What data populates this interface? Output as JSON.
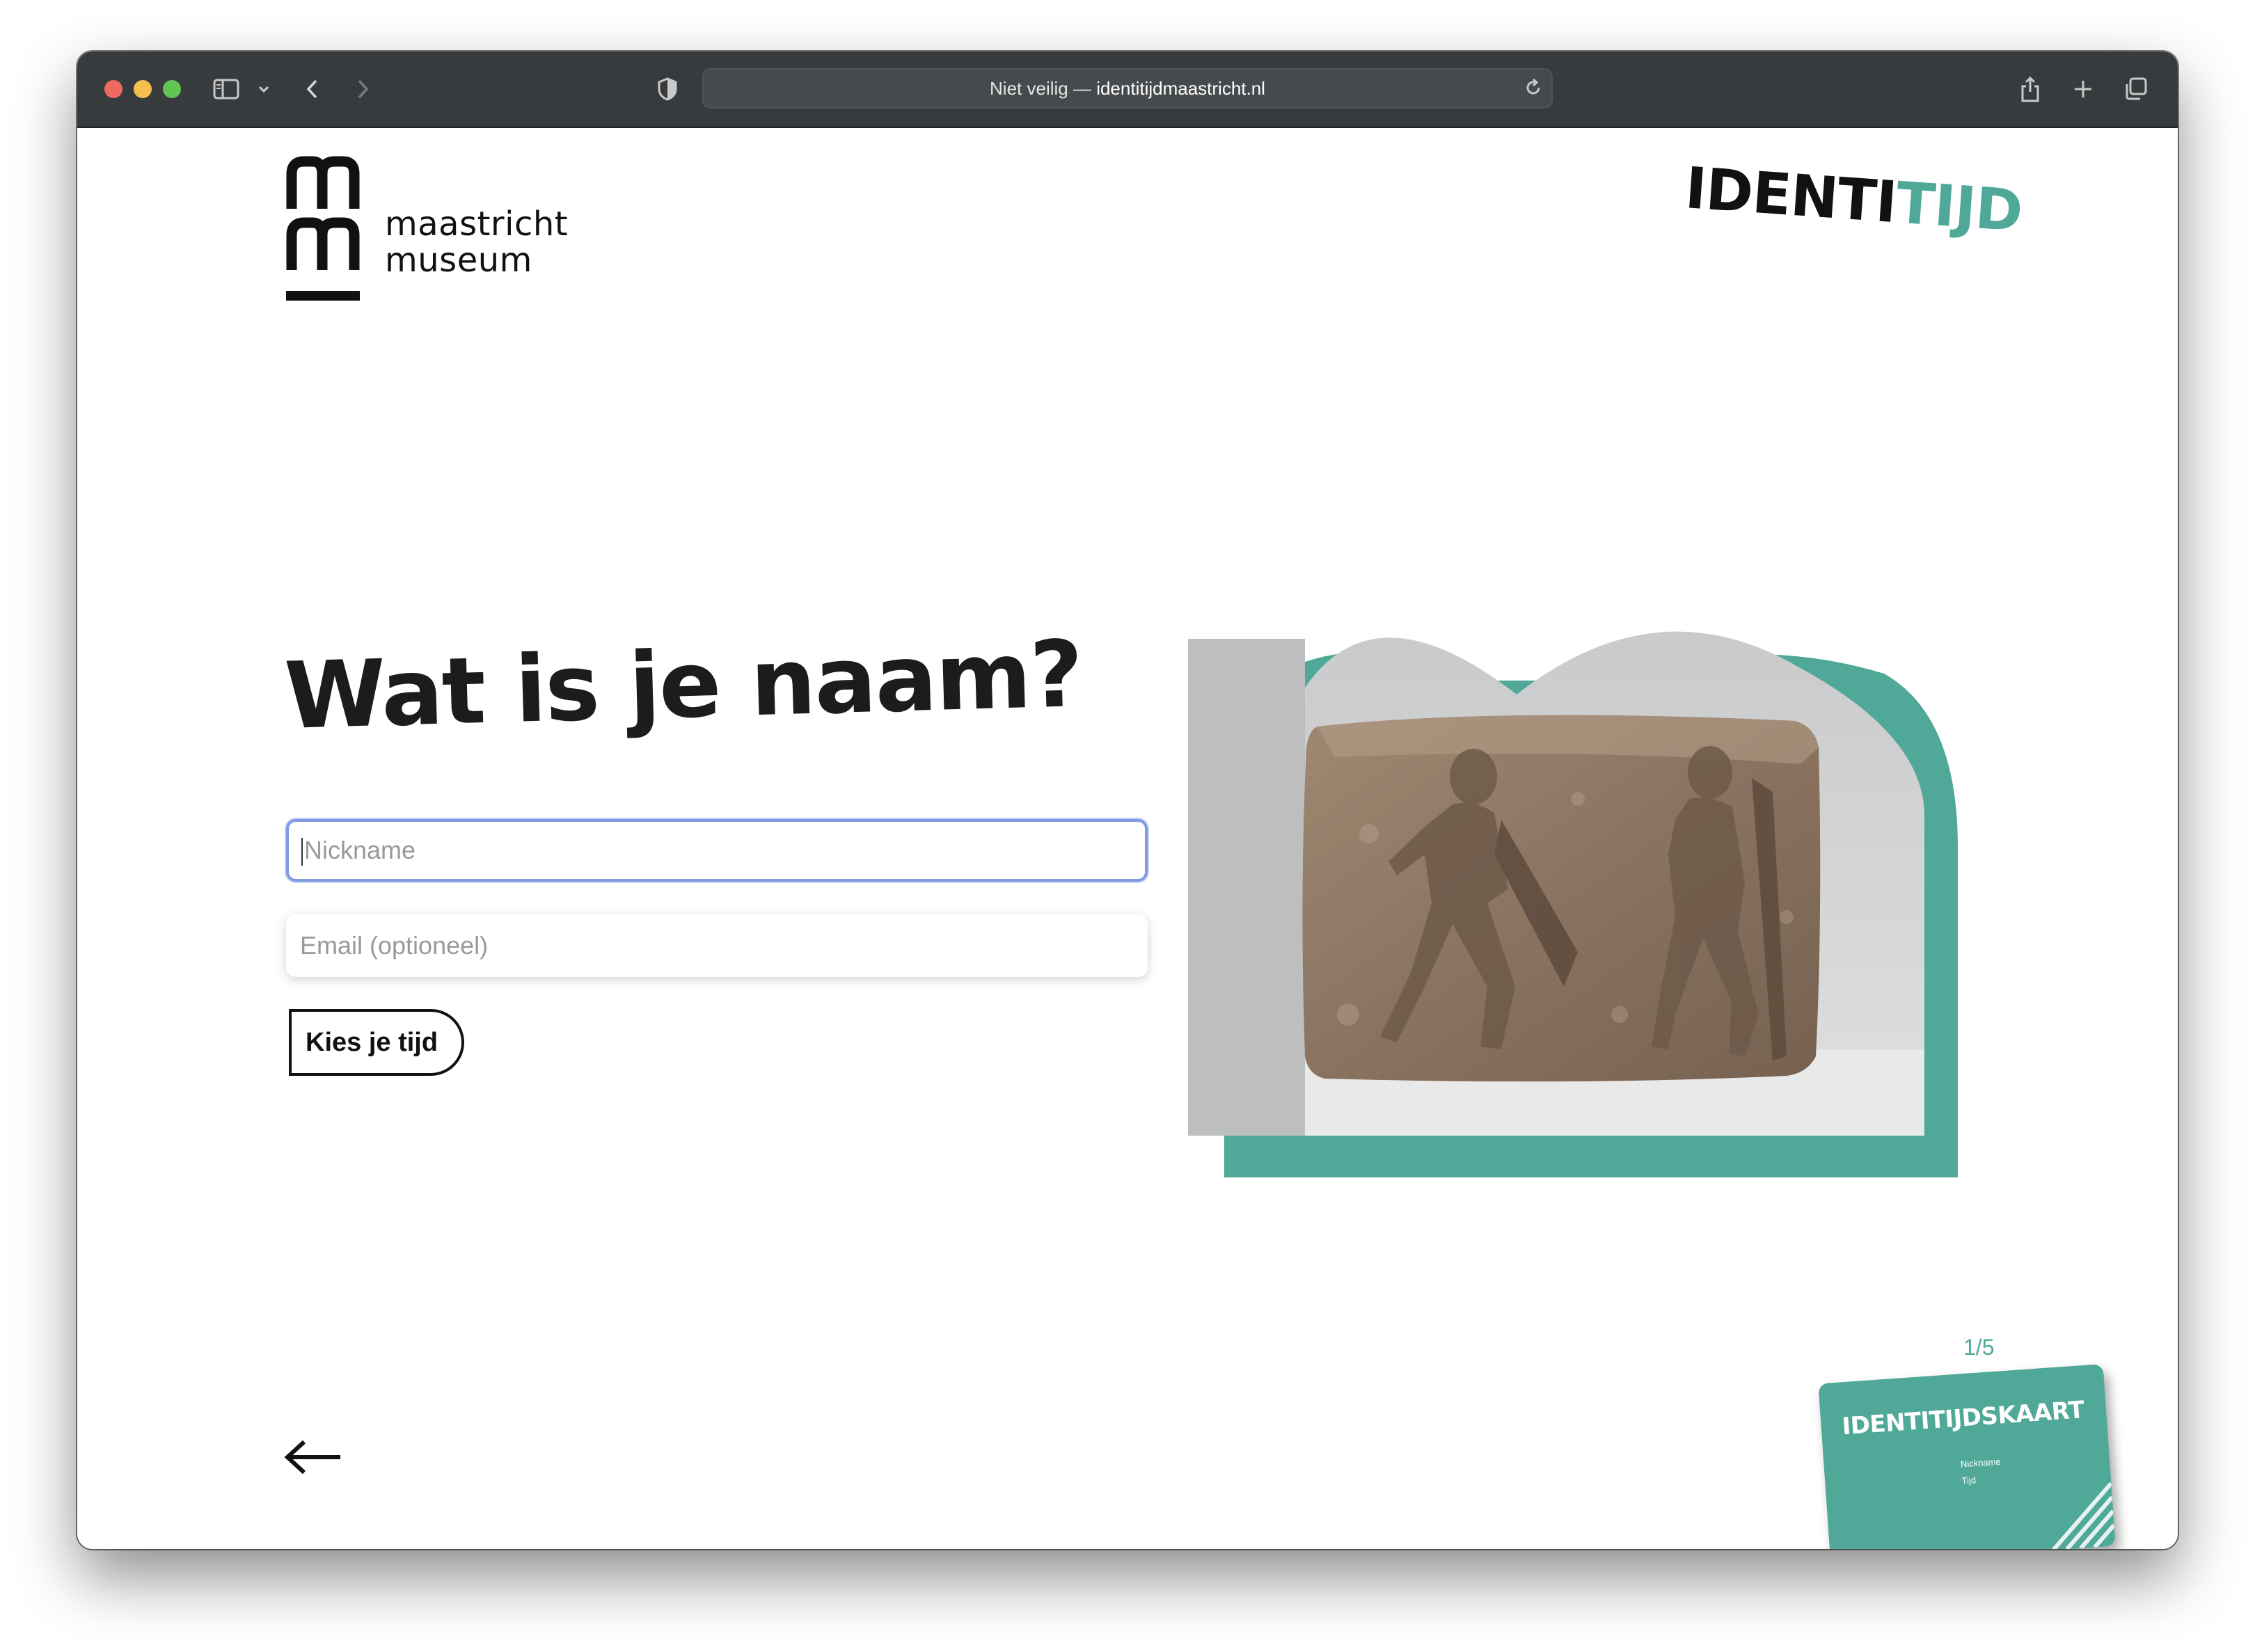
{
  "browser": {
    "url_prefix": "Niet veilig — ",
    "url_host": "identitijdmaastricht.nl"
  },
  "museum_logo": {
    "line1": "maastricht",
    "line2": "museum"
  },
  "brand_logo": {
    "main": "IDENTI",
    "accent": "TIJD"
  },
  "form": {
    "headline": "Wat is je naam?",
    "nickname_placeholder": "Nickname",
    "email_placeholder": "Email (optioneel)",
    "submit_label": "Kies je tijd"
  },
  "progress": {
    "label": "1/5",
    "current": 1,
    "total": 5
  },
  "id_card": {
    "title_main": "IDENTITIJD",
    "title_rest": "SKAART",
    "field_nickname": "Nickname",
    "field_time": "Tijd"
  },
  "colors": {
    "accent": "#4fa898",
    "chrome": "#383b3d",
    "focus": "#7f9ae3"
  },
  "icons": [
    "sidebar-icon",
    "chevron-down-icon",
    "back-icon",
    "forward-icon",
    "shield-icon",
    "reload-icon",
    "share-icon",
    "plus-icon",
    "tabs-icon",
    "arrow-left-icon"
  ]
}
